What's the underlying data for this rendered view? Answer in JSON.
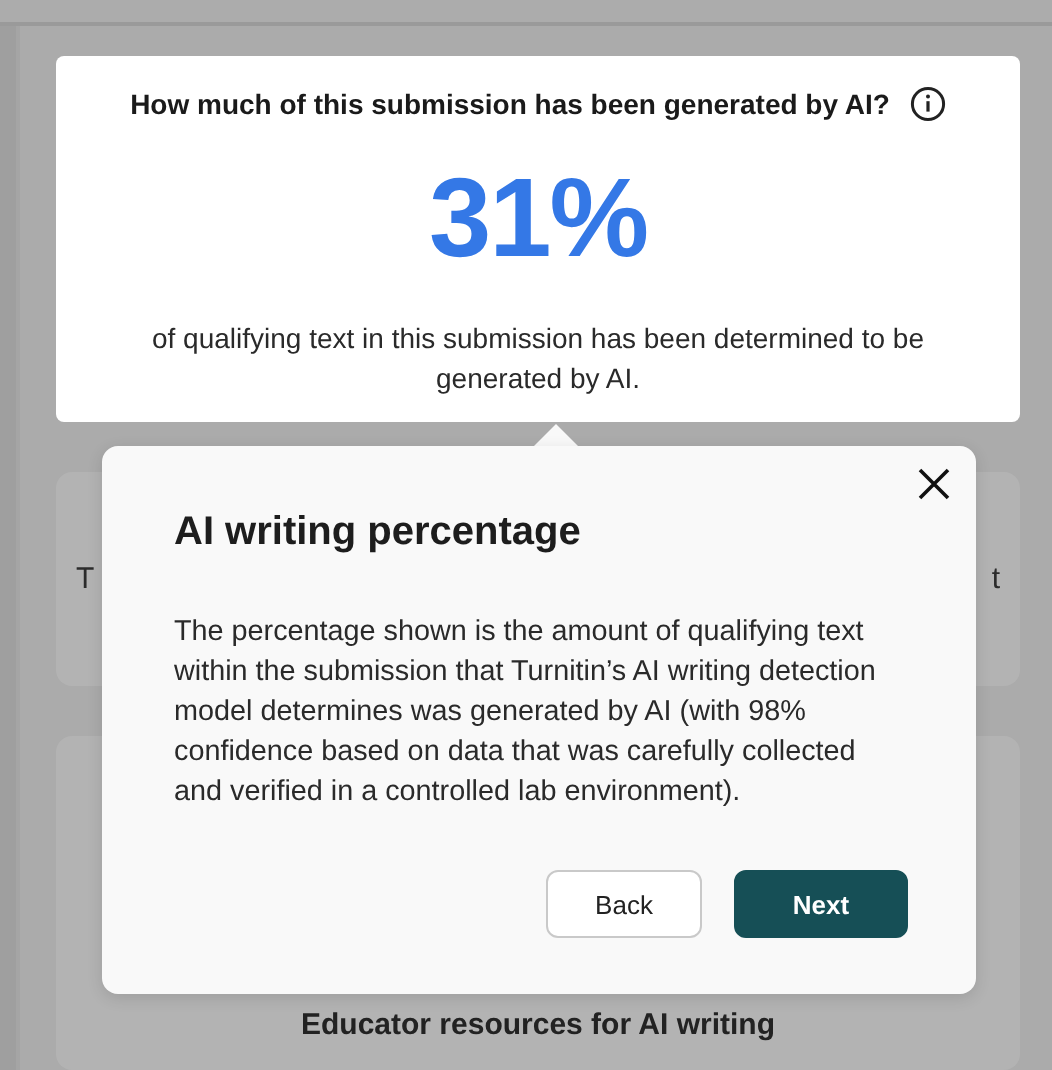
{
  "summary_card": {
    "question": "How much of this submission has been generated by AI?",
    "percentage": "31%",
    "description": "of qualifying text in this submission has been determined to be generated by AI."
  },
  "background_cards": [
    {
      "kind": "partial",
      "text_start": "T",
      "text_end": "t"
    },
    {
      "kind": "titled",
      "title": "Educator resources for AI writing"
    }
  ],
  "popover": {
    "title": "AI writing percentage",
    "body": "The percentage shown is the amount of qualifying text within the submission that Turnitin’s AI writing detection model determines was generated by AI (with 98% confidence based on data that was carefully collected and verified in a controlled lab environment).",
    "buttons": [
      {
        "label": "Back",
        "kind": "secondary"
      },
      {
        "label": "Next",
        "kind": "primary"
      }
    ]
  }
}
